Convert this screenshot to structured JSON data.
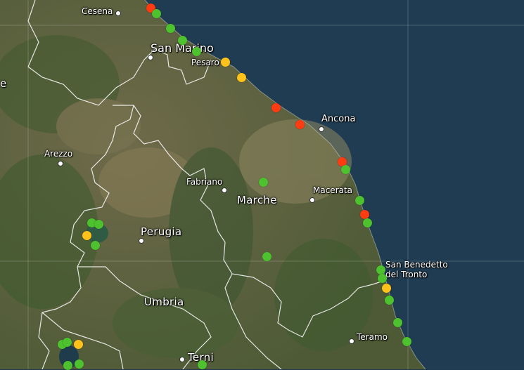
{
  "places": [
    {
      "id": "cesena",
      "name": "Cesena",
      "cls": "small"
    },
    {
      "id": "san-marino",
      "name": "San Marino",
      "cls": "huge"
    },
    {
      "id": "pesaro",
      "name": "Pesaro",
      "cls": "small"
    },
    {
      "id": "ancona",
      "name": "Ancona",
      "cls": "med"
    },
    {
      "id": "arezzo",
      "name": "Arezzo",
      "cls": "small"
    },
    {
      "id": "fabriano",
      "name": "Fabriano",
      "cls": "small"
    },
    {
      "id": "macerata",
      "name": "Macerata",
      "cls": "small"
    },
    {
      "id": "marche",
      "name": "Marche",
      "cls": "big"
    },
    {
      "id": "perugia",
      "name": "Perugia",
      "cls": "big"
    },
    {
      "id": "san-benedetto-1",
      "name": "San Benedetto",
      "cls": "small"
    },
    {
      "id": "san-benedetto-2",
      "name": "del Tronto",
      "cls": "small"
    },
    {
      "id": "umbria",
      "name": "Umbria",
      "cls": "big"
    },
    {
      "id": "teramo",
      "name": "Teramo",
      "cls": "small"
    },
    {
      "id": "terni",
      "name": "Terni",
      "cls": "big"
    },
    {
      "id": "edge-e",
      "name": "e",
      "cls": "big"
    }
  ],
  "status_colors": {
    "green": "#4ec22e",
    "yellow": "#ffc21a",
    "red": "#ff3b12"
  },
  "stations": [
    {
      "status": "red"
    },
    {
      "status": "green"
    },
    {
      "status": "green"
    },
    {
      "status": "green"
    },
    {
      "status": "green"
    },
    {
      "status": "yellow"
    },
    {
      "status": "yellow"
    },
    {
      "status": "red"
    },
    {
      "status": "red"
    },
    {
      "status": "red"
    },
    {
      "status": "green"
    },
    {
      "status": "green"
    },
    {
      "status": "red"
    },
    {
      "status": "green"
    },
    {
      "status": "green"
    },
    {
      "status": "green"
    },
    {
      "status": "yellow"
    },
    {
      "status": "green"
    },
    {
      "status": "green"
    },
    {
      "status": "green"
    },
    {
      "status": "green"
    },
    {
      "status": "green"
    },
    {
      "status": "green"
    },
    {
      "status": "yellow"
    },
    {
      "status": "green"
    },
    {
      "status": "green"
    },
    {
      "status": "yellow"
    },
    {
      "status": "green"
    },
    {
      "status": "green"
    },
    {
      "status": "green"
    },
    {
      "status": "green"
    },
    {
      "status": "green"
    }
  ]
}
